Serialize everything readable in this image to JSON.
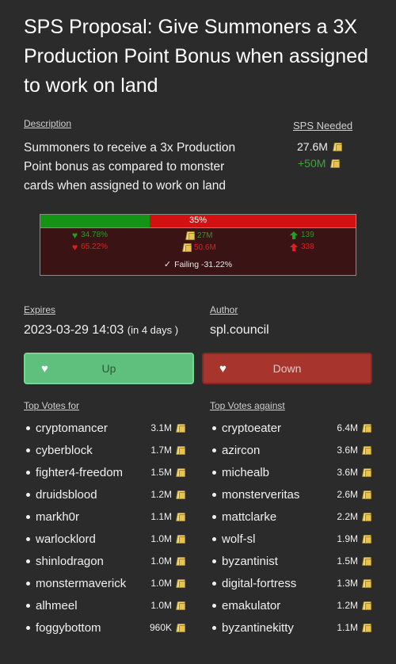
{
  "proposal": {
    "title": "SPS Proposal: Give Summoners a 3X Production Point Bonus when assigned to work on land"
  },
  "description": {
    "label": "Description",
    "text": "Summoners to receive a 3x Production Point bonus as compared to monster cards when assigned to work on land"
  },
  "sps": {
    "label": "SPS Needed",
    "needed": "27.6M",
    "surplus": "+50M"
  },
  "vote_summary": {
    "percent_label": "35%",
    "percent_for": 34.78,
    "for": {
      "percent": "34.78%",
      "amount": "27M",
      "voters": "139"
    },
    "against": {
      "percent": "65.22%",
      "amount": "50.6M",
      "voters": "338"
    },
    "status": "Failing -31.22%",
    "colors": {
      "for": "#149414",
      "against": "#d31111"
    }
  },
  "expires": {
    "label": "Expires",
    "date": "2023-03-29 14:03",
    "relative": "(in 4 days )"
  },
  "author": {
    "label": "Author",
    "name": "spl.council"
  },
  "buttons": {
    "up": "Up",
    "down": "Down"
  },
  "top_for": {
    "label": "Top Votes for",
    "items": [
      {
        "name": "cryptomancer",
        "amount": "3.1M"
      },
      {
        "name": "cyberblock",
        "amount": "1.7M"
      },
      {
        "name": "fighter4-freedom",
        "amount": "1.5M"
      },
      {
        "name": "druidsblood",
        "amount": "1.2M"
      },
      {
        "name": "markh0r",
        "amount": "1.1M"
      },
      {
        "name": "warlocklord",
        "amount": "1.0M"
      },
      {
        "name": "shinlodragon",
        "amount": "1.0M"
      },
      {
        "name": "monstermaverick",
        "amount": "1.0M"
      },
      {
        "name": "alhmeel",
        "amount": "1.0M"
      },
      {
        "name": "foggybottom",
        "amount": "960K"
      }
    ]
  },
  "top_against": {
    "label": "Top Votes against",
    "items": [
      {
        "name": "cryptoeater",
        "amount": "6.4M"
      },
      {
        "name": "azircon",
        "amount": "3.6M"
      },
      {
        "name": "michealb",
        "amount": "3.6M"
      },
      {
        "name": "monsterveritas",
        "amount": "2.6M"
      },
      {
        "name": "mattclarke",
        "amount": "2.2M"
      },
      {
        "name": "wolf-sl",
        "amount": "1.9M"
      },
      {
        "name": "byzantinist",
        "amount": "1.5M"
      },
      {
        "name": "digital-fortress",
        "amount": "1.3M"
      },
      {
        "name": "emakulator",
        "amount": "1.2M"
      },
      {
        "name": "byzantinekitty",
        "amount": "1.1M"
      }
    ]
  },
  "icons": {
    "token": "sps-token-icon",
    "heart": "heart-icon",
    "broken_heart": "broken-heart-icon",
    "arrow_up": "arrow-up-icon",
    "check": "check-icon"
  }
}
